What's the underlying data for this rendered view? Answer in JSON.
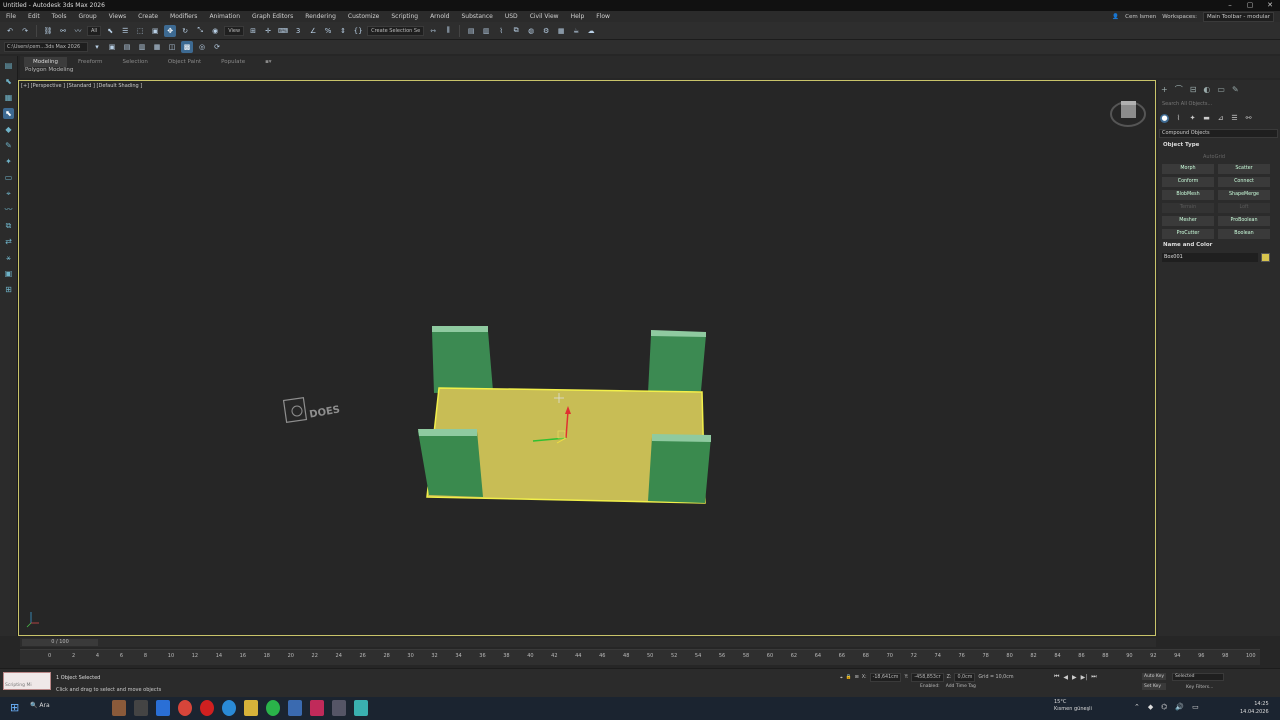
{
  "window": {
    "title": "Untitled - Autodesk 3ds Max 2026",
    "controls": [
      "–",
      "▢",
      "✕"
    ]
  },
  "menu": [
    "File",
    "Edit",
    "Tools",
    "Group",
    "Views",
    "Create",
    "Modifiers",
    "Animation",
    "Graph Editors",
    "Rendering",
    "Customize",
    "Scripting",
    "Arnold",
    "Substance",
    "USD",
    "Civil View",
    "Help",
    "Flow"
  ],
  "user": {
    "name": "Cem Ismen",
    "workspace_label": "Workspaces:",
    "workspace_value": "Main Toolbar - modular"
  },
  "toolbar": {
    "selection_filter": "All",
    "ref_coord": "View",
    "named_selection": "Create Selection Se"
  },
  "toolbar2": {
    "project_path": "C:\\Users\\cem...3ds Max 2026"
  },
  "ribbon": {
    "tabs": [
      "Modeling",
      "Freeform",
      "Selection",
      "Object Paint",
      "Populate"
    ],
    "active_tab": "Modeling",
    "panel_label": "Polygon Modeling"
  },
  "viewport": {
    "label": "[+] [Perspective ] [Standard ] [Default Shading ]"
  },
  "command_panel": {
    "search_placeholder": "Search All Objects...",
    "category": "Compound Objects",
    "object_type_header": "Object Type",
    "autogrid": "AutoGrid",
    "buttons": [
      "Morph",
      "Scatter",
      "Conform",
      "Connect",
      "BlobMesh",
      "ShapeMerge",
      "Terrain",
      "Loft",
      "Mesher",
      "ProBoolean",
      "ProCutter",
      "Boolean"
    ],
    "disabled_buttons": [
      "Terrain",
      "Loft"
    ],
    "name_color_header": "Name and Color",
    "object_name": "Box001",
    "object_color": "#d8c54e"
  },
  "timeline": {
    "frame_indicator": "0 / 100",
    "ticks": [
      "0",
      "2",
      "4",
      "6",
      "8",
      "10",
      "12",
      "14",
      "16",
      "18",
      "20",
      "22",
      "24",
      "26",
      "28",
      "30",
      "32",
      "34",
      "36",
      "38",
      "40",
      "42",
      "44",
      "46",
      "48",
      "50",
      "52",
      "54",
      "56",
      "58",
      "60",
      "62",
      "64",
      "66",
      "68",
      "70",
      "72",
      "74",
      "76",
      "78",
      "80",
      "82",
      "84",
      "86",
      "88",
      "90",
      "92",
      "94",
      "96",
      "98",
      "100"
    ]
  },
  "status": {
    "scripting_label": "Scripting Mi",
    "objects_selected": "1 Object Selected",
    "hint": "Click and drag to select and move objects",
    "x_label": "X:",
    "x_value": "-18,641cm",
    "y_label": "Y:",
    "y_value": "-458,853cr",
    "z_label": "Z:",
    "z_value": "0,0cm",
    "grid": "Grid = 10,0cm",
    "enabled": "Enabled:",
    "add_time_tag": "Add Time Tag",
    "auto_key": "Auto Key",
    "set_key": "Set Key",
    "selected": "Selected",
    "key_filters": "Key Filters..."
  },
  "taskbar": {
    "search": "Ara",
    "weather_temp": "15°C",
    "weather_desc": "Kısmen güneşli",
    "time": "14:25",
    "date": "14.04.2026"
  },
  "colors": {
    "accent": "#3d6a92",
    "selection": "#f2f04a",
    "box": "#c8bd55",
    "pillars": "#3f8f55"
  }
}
